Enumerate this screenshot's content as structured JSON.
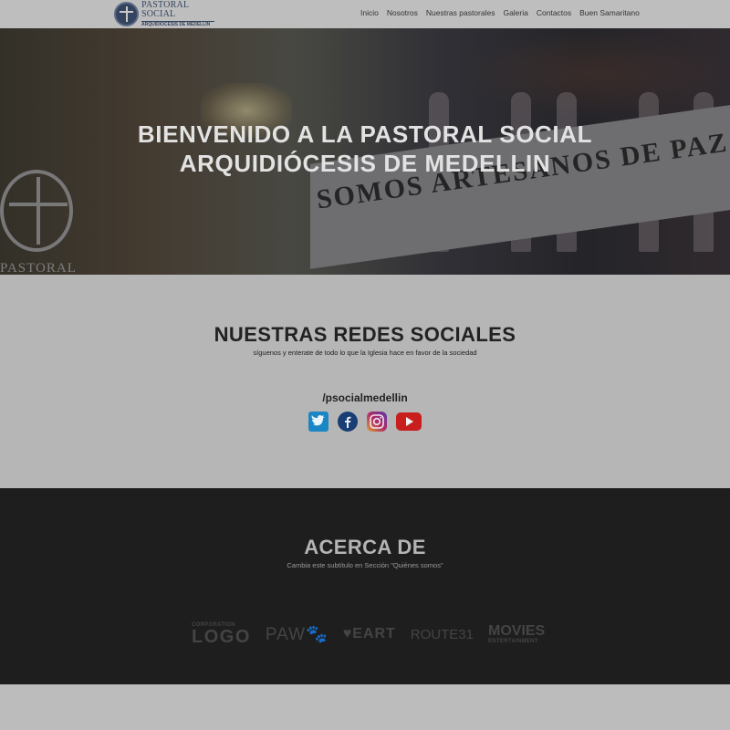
{
  "brand": {
    "line1": "PASTORAL SOCIAL",
    "line2": "ARQUIDIÓCESIS DE MEDELLÍN"
  },
  "nav": {
    "items": [
      "Inicio",
      "Nosotros",
      "Nuestras pastorales",
      "Galeria",
      "Contactos",
      "Buen Samaritano"
    ]
  },
  "hero": {
    "title_line1": "BIENVENIDO A LA PASTORAL SOCIAL",
    "title_line2": "ARQUIDIÓCESIS DE MEDELLIN",
    "banner_text": "SOMOS ARTESANOS DE PAZ",
    "emblem_text": "PASTORAL"
  },
  "social": {
    "title": "NUESTRAS REDES SOCIALES",
    "subtitle": "síguenos y enterate de todo lo que la Iglesia hace en favor de la sociedad",
    "handle": "/psocialmedellin",
    "icons": [
      "twitter-icon",
      "facebook-icon",
      "instagram-icon",
      "youtube-icon"
    ]
  },
  "about": {
    "title": "ACERCA DE",
    "subtitle": "Cambia este subtítulo en Sección \"Quiénes somos\"",
    "logos": {
      "corp_small": "CORPORATION",
      "corp_big": "LOGO",
      "paw": "PAW",
      "heart": "EART",
      "route": "ROUTE31",
      "movies_big": "MOVIES",
      "movies_small": "ENTERTAINMENT"
    }
  },
  "colors": {
    "twitter": "#1da1f2",
    "facebook": "#1a4a8a",
    "youtube": "#d42020",
    "dark_section": "#1e1e1e",
    "light_section": "#b6b6b6"
  }
}
